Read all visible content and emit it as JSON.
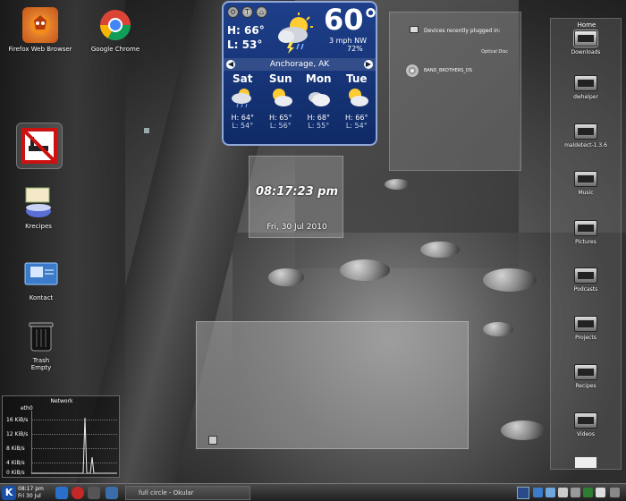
{
  "desktop_icons": [
    {
      "label": "Firefox Web Browser",
      "icon": "firefox-icon"
    },
    {
      "label": "Google Chrome",
      "icon": "chrome-icon"
    },
    {
      "label": "",
      "icon": "no-entry-icon"
    },
    {
      "label": "Krecipes",
      "icon": "krecipes-icon"
    },
    {
      "label": "Kontact",
      "icon": "kontact-icon"
    },
    {
      "label": "Trash\nEmpty",
      "icon": "trash-icon"
    }
  ],
  "weather": {
    "high": "H: 66°",
    "low": "L: 53°",
    "temperature": "60°",
    "wind": "3 mph NW",
    "humidity": "72%",
    "location": "Anchorage, AK",
    "days": [
      {
        "name": "Sat",
        "high": "H: 64°",
        "low": "L: 54°",
        "icon": "rain-icon"
      },
      {
        "name": "Sun",
        "high": "H: 65°",
        "low": "L: 56°",
        "icon": "partly-cloudy-icon"
      },
      {
        "name": "Mon",
        "high": "H: 68°",
        "low": "L: 55°",
        "icon": "cloudy-icon"
      },
      {
        "name": "Tue",
        "high": "H: 66°",
        "low": "L: 54°",
        "icon": "partly-cloudy-icon"
      }
    ]
  },
  "clock": {
    "time": "08:17:23 pm",
    "date": "Fri, 30 Jul 2010"
  },
  "device_notifier": {
    "title": "Devices recently plugged in:",
    "category": "Optical Disc",
    "device": "BAND_BROTHERS_DS"
  },
  "folder_view": {
    "title": "Home",
    "items": [
      "Downloads",
      "dwhelper",
      "maldetect-1.3.6",
      "Music",
      "Pictures",
      "Podcasts",
      "Projects",
      "Recipes",
      "Videos"
    ]
  },
  "network": {
    "title": "Network",
    "interface": "eth0",
    "y_labels": [
      "16 KiB/s",
      "12 KiB/s",
      "8 KiB/s",
      "4 KiB/s",
      "0 KiB/s"
    ]
  },
  "taskbar": {
    "clock_time": "08:17 pm",
    "clock_date": "Fri 30 Jul",
    "task": "full circle - Okular"
  }
}
